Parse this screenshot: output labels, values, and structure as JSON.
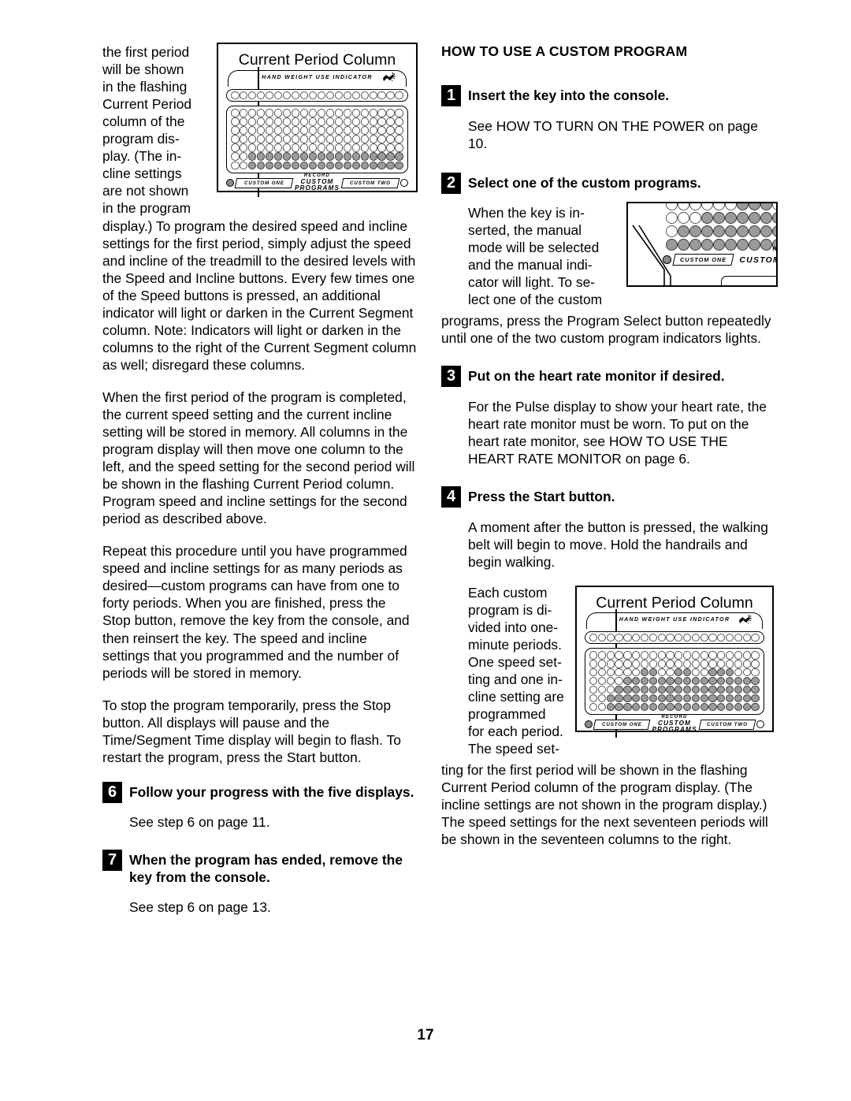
{
  "page_number": "17",
  "left_column": {
    "wrap_text_lines": [
      "the first period",
      "will be shown",
      "in the flashing",
      "Current Period",
      "column of the",
      "program dis-",
      "play. (The in-",
      "cline settings",
      "are not shown",
      "in the program"
    ],
    "paragraph_1": "display.) To program the desired speed and incline settings for the first period, simply adjust the speed and incline of the treadmill to the desired levels with the Speed and Incline buttons. Every few times one of the Speed buttons is pressed, an additional indicator will light or darken in the Current Segment column. Note: Indicators will light or darken in the columns to the right of the Current Segment column as well; disregard these columns.",
    "paragraph_2": "When the first period of the program is completed, the current speed setting and the current incline setting will be stored in memory. All columns in the program display will then move one column to the left, and the speed setting for the second period will be shown in the flashing Current Period column. Program speed and incline settings for the second period as described above.",
    "paragraph_3": "Repeat this procedure until you have programmed speed and incline settings for as many periods as desired—custom programs can have from one to forty periods. When you are finished, press the Stop button, remove the key from the console, and then reinsert the key. The speed and incline settings that you programmed and the number of periods will be stored in memory.",
    "paragraph_4": "To stop the program temporarily, press the Stop button. All displays will pause and the Time/Segment Time display will begin to flash. To restart the program, press the Start button.",
    "step_6": {
      "number": "6",
      "title": "Follow your progress with the five displays.",
      "body": "See step 6 on page 11."
    },
    "step_7": {
      "number": "7",
      "title": "When the program has ended, remove the key from the console.",
      "body": "See step 6 on page 13."
    },
    "figure": {
      "caption": "Current Period Column",
      "hand_weight_label": "HAND WEIGHT USE INDICATOR",
      "custom_one_label": "CUSTOM ONE",
      "custom_two_label": "CUSTOM TWO",
      "record_label_line1": "RECORD",
      "record_label_line2": "CUSTOM PROGRAMS"
    }
  },
  "right_column": {
    "heading": "HOW TO USE A CUSTOM PROGRAM",
    "step_1": {
      "number": "1",
      "title": "Insert the key into the console.",
      "body": "See HOW TO TURN ON THE POWER on page 10."
    },
    "step_2": {
      "number": "2",
      "title": "Select one of the custom programs.",
      "wrap_text_lines": [
        "When the key is in-",
        "serted, the manual",
        "mode will be selected",
        "and the manual indi-",
        "cator will light. To se-",
        "lect one of the custom"
      ],
      "body_rest": "programs, press the Program Select button repeatedly until one of the two custom program indicators lights.",
      "figure": {
        "custom_one_label": "CUSTOM ONE",
        "custom_label": "CUSTOM",
        "re_label": "R E"
      }
    },
    "step_3": {
      "number": "3",
      "title": "Put on the heart rate monitor if desired.",
      "body": "For the Pulse display to show your heart rate, the heart rate monitor must be worn. To put on the heart rate monitor, see HOW TO USE THE HEART RATE MONITOR on page 6."
    },
    "step_4": {
      "number": "4",
      "title": "Press the Start button.",
      "body": "A moment after the button is pressed, the walking belt will begin to move. Hold the handrails and begin walking.",
      "wrap_text_lines": [
        "Each custom",
        "program is di-",
        "vided into one-",
        "minute periods.",
        "One speed set-",
        "ting and one in-",
        "cline setting are",
        "programmed",
        "for each period.",
        "The speed set-"
      ],
      "body_rest": "ting for the first period will be shown in the flashing Current Period column of the program display. (The incline settings are not shown in the program display.) The speed settings for the next seventeen periods will be shown in the seventeen columns to the right."
    },
    "figure": {
      "caption": "Current Period Column",
      "hand_weight_label": "HAND WEIGHT USE INDICATOR",
      "custom_one_label": "CUSTOM ONE",
      "custom_two_label": "CUSTOM TWO",
      "record_label_line1": "RECORD",
      "record_label_line2": "CUSTOM PROGRAMS"
    }
  },
  "led_patterns": {
    "figure_top_left": [
      [
        0,
        0,
        0,
        0,
        0,
        0,
        0,
        0,
        0,
        0,
        0,
        0,
        0,
        0,
        0,
        0,
        0,
        0,
        0,
        0
      ],
      [
        0,
        0,
        0,
        0,
        0,
        0,
        0,
        0,
        0,
        0,
        0,
        0,
        0,
        0,
        0,
        0,
        0,
        0,
        0,
        0
      ],
      [
        0,
        0,
        0,
        0,
        0,
        0,
        0,
        0,
        0,
        0,
        0,
        0,
        0,
        0,
        0,
        0,
        0,
        0,
        0,
        0
      ],
      [
        0,
        0,
        0,
        0,
        0,
        0,
        0,
        0,
        0,
        0,
        0,
        0,
        0,
        0,
        0,
        0,
        0,
        0,
        0,
        0
      ],
      [
        0,
        0,
        0,
        0,
        0,
        0,
        0,
        0,
        0,
        0,
        0,
        0,
        0,
        0,
        0,
        0,
        0,
        0,
        0,
        0
      ],
      [
        0,
        0,
        1,
        1,
        1,
        1,
        1,
        1,
        1,
        1,
        1,
        1,
        1,
        1,
        1,
        1,
        1,
        1,
        1,
        1
      ],
      [
        0,
        0,
        1,
        1,
        1,
        1,
        1,
        1,
        1,
        1,
        1,
        1,
        1,
        1,
        1,
        1,
        1,
        1,
        1,
        1
      ]
    ],
    "figure_bottom_right": [
      [
        0,
        0,
        0,
        0,
        0,
        0,
        0,
        0,
        0,
        0,
        0,
        0,
        0,
        0,
        0,
        0,
        0,
        0,
        0,
        0
      ],
      [
        0,
        0,
        0,
        0,
        0,
        0,
        0,
        0,
        0,
        0,
        0,
        0,
        0,
        0,
        0,
        0,
        0,
        0,
        0,
        0
      ],
      [
        0,
        0,
        0,
        0,
        0,
        0,
        1,
        1,
        0,
        0,
        1,
        1,
        0,
        0,
        1,
        1,
        1,
        0,
        0,
        0
      ],
      [
        0,
        0,
        0,
        0,
        1,
        1,
        1,
        1,
        1,
        1,
        1,
        1,
        1,
        1,
        1,
        1,
        1,
        1,
        1,
        1
      ],
      [
        0,
        0,
        0,
        1,
        1,
        1,
        1,
        1,
        1,
        1,
        1,
        1,
        1,
        1,
        1,
        1,
        1,
        1,
        1,
        1
      ],
      [
        0,
        0,
        1,
        1,
        1,
        1,
        1,
        1,
        1,
        1,
        1,
        1,
        1,
        1,
        1,
        1,
        1,
        1,
        1,
        1
      ],
      [
        0,
        0,
        1,
        1,
        1,
        1,
        1,
        1,
        1,
        1,
        1,
        1,
        1,
        1,
        1,
        1,
        1,
        1,
        1,
        1
      ]
    ],
    "figure_zoom_step2": [
      [
        0,
        0,
        0,
        0,
        0,
        0,
        1,
        1,
        1,
        0,
        0
      ],
      [
        0,
        0,
        0,
        1,
        1,
        1,
        1,
        1,
        1,
        1,
        1
      ],
      [
        0,
        1,
        1,
        1,
        1,
        1,
        1,
        1,
        1,
        1,
        1
      ],
      [
        1,
        1,
        1,
        1,
        1,
        1,
        1,
        1,
        1,
        1,
        1
      ]
    ]
  }
}
